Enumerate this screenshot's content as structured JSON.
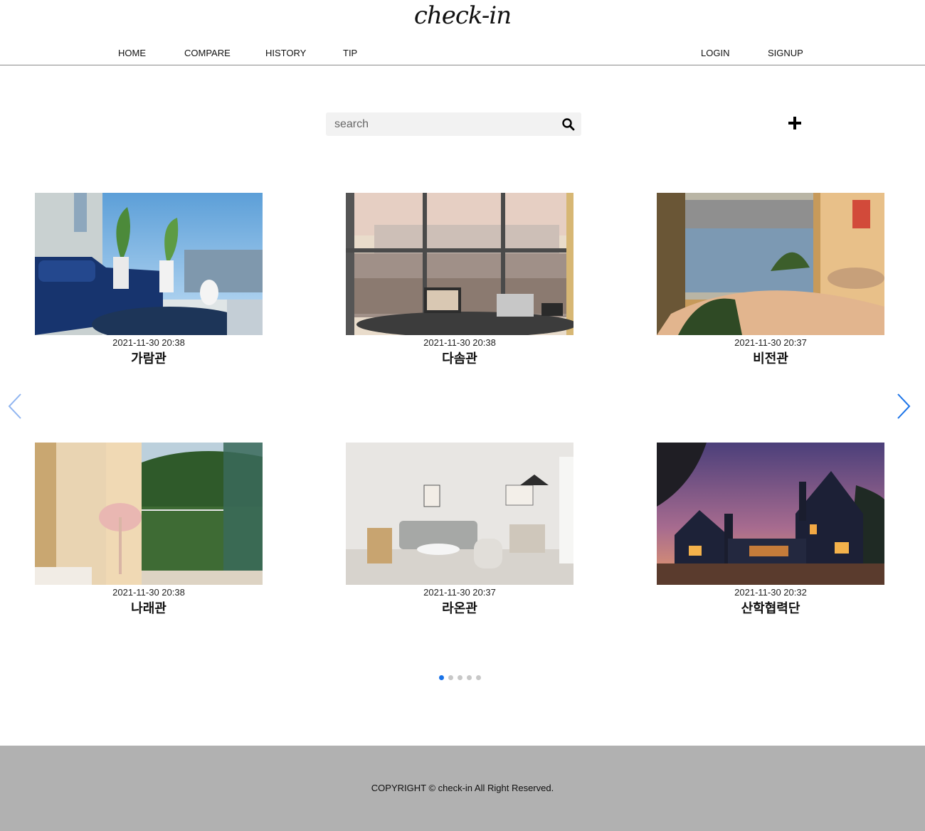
{
  "header": {
    "logo": "check-in"
  },
  "nav": {
    "left": [
      {
        "label": "HOME"
      },
      {
        "label": "COMPARE"
      },
      {
        "label": "HISTORY"
      },
      {
        "label": "TIP"
      }
    ],
    "right": [
      {
        "label": "LOGIN"
      },
      {
        "label": "SIGNUP"
      }
    ]
  },
  "search": {
    "placeholder": "search",
    "value": "",
    "icon": "search-icon"
  },
  "add_button": {
    "icon": "plus-icon"
  },
  "cards": [
    {
      "date": "2021-11-30 20:38",
      "title": "가람관",
      "image": "living-room-blue-sofa-photo"
    },
    {
      "date": "2021-11-30 20:38",
      "title": "다솜관",
      "image": "desk-city-view-photo"
    },
    {
      "date": "2021-11-30 20:37",
      "title": "비전관",
      "image": "bedroom-river-view-photo"
    },
    {
      "date": "2021-11-30 20:38",
      "title": "나래관",
      "image": "room-forest-view-photo"
    },
    {
      "date": "2021-11-30 20:37",
      "title": "라온관",
      "image": "white-living-room-photo"
    },
    {
      "date": "2021-11-30 20:32",
      "title": "산학협력단",
      "image": "house-dusk-photo"
    }
  ],
  "carousel": {
    "prev_icon": "chevron-left-icon",
    "next_icon": "chevron-right-icon",
    "page_count": 5,
    "active_page": 1,
    "accent": "#1a73e8"
  },
  "footer": {
    "copyright": "COPYRIGHT © check-in All Right Reserved."
  }
}
